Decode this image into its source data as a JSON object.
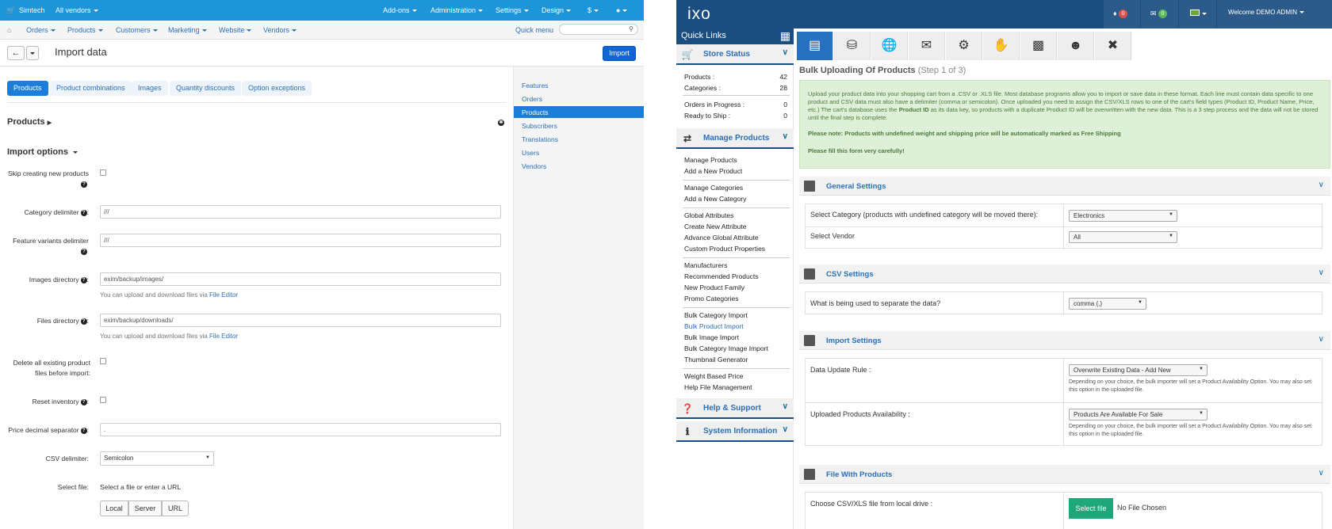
{
  "left": {
    "topbar": {
      "store_name": "Simtech",
      "vendor_select": "All vendors",
      "menus": [
        "Add-ons",
        "Administration",
        "Settings",
        "Design",
        "$"
      ]
    },
    "menubar": {
      "items": [
        "Orders",
        "Products",
        "Customers",
        "Marketing",
        "Website",
        "Vendors"
      ],
      "quick_menu": "Quick menu"
    },
    "title": "Import data",
    "import_button": "Import",
    "tabs": [
      "Products",
      "Product combinations",
      "Images",
      "Quantity discounts",
      "Option exceptions"
    ],
    "section_products": "Products",
    "section_import_options": "Import options",
    "fields": {
      "skip_creating": "Skip creating new products",
      "category_delimiter": "Category delimiter",
      "category_delimiter_value": "///",
      "feature_variants_delimiter": "Feature variants delimiter",
      "feature_variants_delimiter_value": "///",
      "images_directory": "Images directory",
      "images_directory_value": "exim/backup/images/",
      "files_directory": "Files directory",
      "files_directory_value": "exim/backup/downloads/",
      "hint_prefix": "You can upload and download files via",
      "hint_link": "File Editor",
      "delete_files_line1": "Delete all existing product",
      "delete_files_line2": "files before import",
      "reset_inventory": "Reset inventory",
      "price_decimal_separator": "Price decimal separator",
      "price_decimal_separator_value": ".",
      "csv_delimiter": "CSV delimiter:",
      "csv_delimiter_value": "Semicolon",
      "select_file": "Select file:",
      "select_file_text": "Select a file or enter a URL",
      "file_buttons": [
        "Local",
        "Server",
        "URL"
      ]
    },
    "sidenav": [
      "Features",
      "Orders",
      "Products",
      "Subscribers",
      "Translations",
      "Users",
      "Vendors"
    ]
  },
  "right": {
    "logo": "ixo",
    "header": {
      "bell_count": "0",
      "mail_count": "0",
      "welcome": "Welcome DEMO ADMIN"
    },
    "quick_links": "Quick Links",
    "store_status": {
      "title": "Store Status",
      "rows": [
        {
          "label": "Products :",
          "value": "42"
        },
        {
          "label": "Categories :",
          "value": "28"
        },
        {
          "label": "Orders in Progress :",
          "value": "0"
        },
        {
          "label": "Ready to Ship :",
          "value": "0"
        }
      ]
    },
    "manage_products": {
      "title": "Manage Products",
      "groups": [
        [
          "Manage Products",
          "Add a New Product"
        ],
        [
          "Manage Categories",
          "Add a New Category"
        ],
        [
          "Global Attributes",
          "Create New Attribute",
          "Advance Global Attribute",
          "Custom Product Properties"
        ],
        [
          "Manufacturers",
          "Recommended Products",
          "New Product Family",
          "Promo Categories"
        ],
        [
          "Bulk Category Import",
          "Bulk Product Import",
          "Bulk Image Import",
          "Bulk Category Image Import",
          "Thumbnail Generator"
        ],
        [
          "Weight Based Price",
          "Help File Management"
        ]
      ]
    },
    "help_support": "Help & Support",
    "system_information": "System Information",
    "page_title": "Bulk Uploading Of Products",
    "page_step": "(Step 1 of 3)",
    "info": {
      "text_a": "Upload your product data into your shopping cart from a .CSV or .XLS file. Most database programs allow you to import or save data in these format. Each line must contain data specific to one product and CSV data must also have a delimiter (comma or semicolon). Once uploaded you need to assign the CSV/XLS rows to one of the cart's field types (Product ID, Product Name, Price, etc.) The cart's database uses the",
      "text_b": "Product ID",
      "text_c": "as its data key, so products with a duplicate Product ID will be overwritten with the new data. This is a 3 step process and the data will not be stored until the final step is complete.",
      "note": "Please note: Products with undefined weight and shipping price will be automatically marked as Free Shipping",
      "careful": "Please fill this form very carefully!"
    },
    "general_settings": {
      "title": "General Settings",
      "category_label": "Select Category (products with undefined category will be moved there):",
      "category_value": "Electronics",
      "vendor_label": "Select Vendor",
      "vendor_value": "All"
    },
    "csv_settings": {
      "title": "CSV Settings",
      "separator_label": "What is being used to separate the data?",
      "separator_value": "comma (,)"
    },
    "import_settings": {
      "title": "Import Settings",
      "update_rule_label": "Data Update Rule :",
      "update_rule_value": "Overwrite Existing Data - Add New",
      "availability_label": "Uploaded Products Availability :",
      "availability_value": "Products Are Available For Sale",
      "hint": "Depending on your choice, the bulk importer will set a Product Availability Option. You may also set this option in the uploaded file."
    },
    "file_with_products": {
      "title": "File With Products",
      "choose_label": "Choose CSV/XLS file from local drive :",
      "button": "Select file",
      "status": "No File Chosen"
    }
  }
}
